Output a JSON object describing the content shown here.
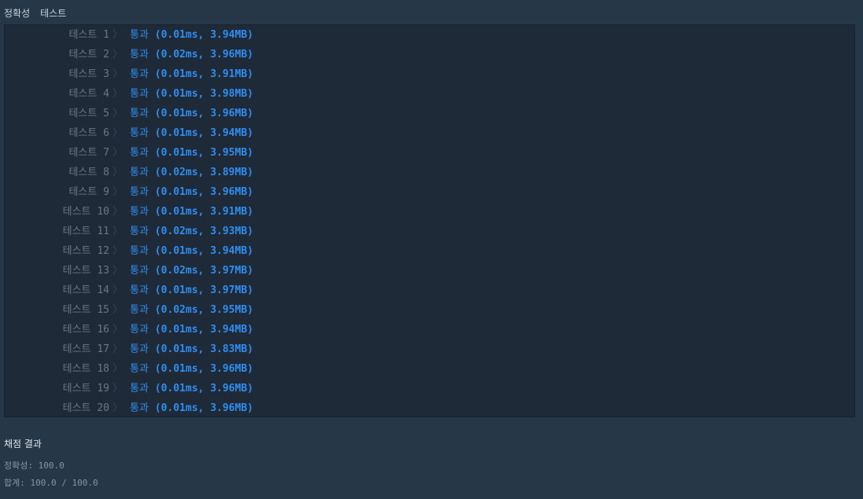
{
  "header": {
    "tab1": "정확성",
    "tab2": "테스트"
  },
  "tests": [
    {
      "label": "테스트 1",
      "time": "0.01ms",
      "mem": "3.94MB"
    },
    {
      "label": "테스트 2",
      "time": "0.02ms",
      "mem": "3.96MB"
    },
    {
      "label": "테스트 3",
      "time": "0.01ms",
      "mem": "3.91MB"
    },
    {
      "label": "테스트 4",
      "time": "0.01ms",
      "mem": "3.98MB"
    },
    {
      "label": "테스트 5",
      "time": "0.01ms",
      "mem": "3.96MB"
    },
    {
      "label": "테스트 6",
      "time": "0.01ms",
      "mem": "3.94MB"
    },
    {
      "label": "테스트 7",
      "time": "0.01ms",
      "mem": "3.95MB"
    },
    {
      "label": "테스트 8",
      "time": "0.02ms",
      "mem": "3.89MB"
    },
    {
      "label": "테스트 9",
      "time": "0.01ms",
      "mem": "3.96MB"
    },
    {
      "label": "테스트 10",
      "time": "0.01ms",
      "mem": "3.91MB"
    },
    {
      "label": "테스트 11",
      "time": "0.02ms",
      "mem": "3.93MB"
    },
    {
      "label": "테스트 12",
      "time": "0.01ms",
      "mem": "3.94MB"
    },
    {
      "label": "테스트 13",
      "time": "0.02ms",
      "mem": "3.97MB"
    },
    {
      "label": "테스트 14",
      "time": "0.01ms",
      "mem": "3.97MB"
    },
    {
      "label": "테스트 15",
      "time": "0.02ms",
      "mem": "3.95MB"
    },
    {
      "label": "테스트 16",
      "time": "0.01ms",
      "mem": "3.94MB"
    },
    {
      "label": "테스트 17",
      "time": "0.01ms",
      "mem": "3.83MB"
    },
    {
      "label": "테스트 18",
      "time": "0.01ms",
      "mem": "3.96MB"
    },
    {
      "label": "테스트 19",
      "time": "0.01ms",
      "mem": "3.96MB"
    },
    {
      "label": "테스트 20",
      "time": "0.01ms",
      "mem": "3.96MB"
    }
  ],
  "pass_text": "통과",
  "separator_glyph": "〉",
  "summary": {
    "title": "채점 결과",
    "accuracy_label": "정확성",
    "accuracy_value": "100.0",
    "total_label": "합계",
    "total_value": "100.0 / 100.0"
  },
  "colors": {
    "background": "#263747",
    "panel": "#1f2a38",
    "pass": "#2f8ef0",
    "label": "#687785"
  }
}
